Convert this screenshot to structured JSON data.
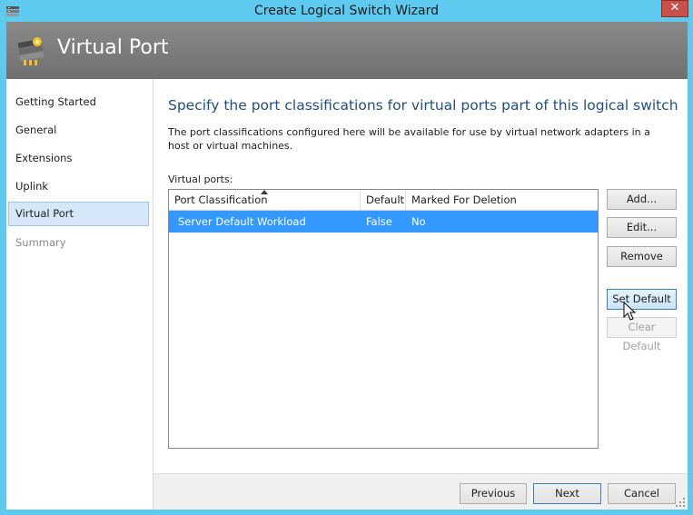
{
  "window": {
    "title": "Create Logical Switch Wizard",
    "close_glyph": "✕"
  },
  "banner": {
    "title": "Virtual Port"
  },
  "nav": {
    "items": [
      {
        "label": "Getting Started"
      },
      {
        "label": "General"
      },
      {
        "label": "Extensions"
      },
      {
        "label": "Uplink"
      },
      {
        "label": "Virtual Port"
      },
      {
        "label": "Summary"
      }
    ]
  },
  "content": {
    "heading": "Specify the port classifications for virtual ports part of this logical switch",
    "description": "The port classifications configured here will be available for use by virtual network adapters in a host or virtual machines.",
    "list_label": "Virtual ports:"
  },
  "table": {
    "columns": [
      "Port Classification",
      "Default",
      "Marked For Deletion"
    ],
    "rows": [
      {
        "classification": "Server Default Workload",
        "default": "False",
        "marked_for_deletion": "No"
      }
    ]
  },
  "buttons": {
    "add": "Add...",
    "edit": "Edit...",
    "remove": "Remove",
    "set_default": "Set Default",
    "clear_default": "Clear Default",
    "previous": "Previous",
    "next": "Next",
    "cancel": "Cancel"
  },
  "colors": {
    "titlebar": "#5fcaf0",
    "banner": "#7a7a7a",
    "heading": "#1f4f82",
    "selection": "#3399ff",
    "close": "#c7504a"
  },
  "icons": {
    "app": "logical-switch-icon",
    "banner": "virtual-port-icon",
    "sort": "sort-ascending-icon",
    "cursor": "mouse-pointer-icon",
    "grip": "resize-grip-icon"
  }
}
